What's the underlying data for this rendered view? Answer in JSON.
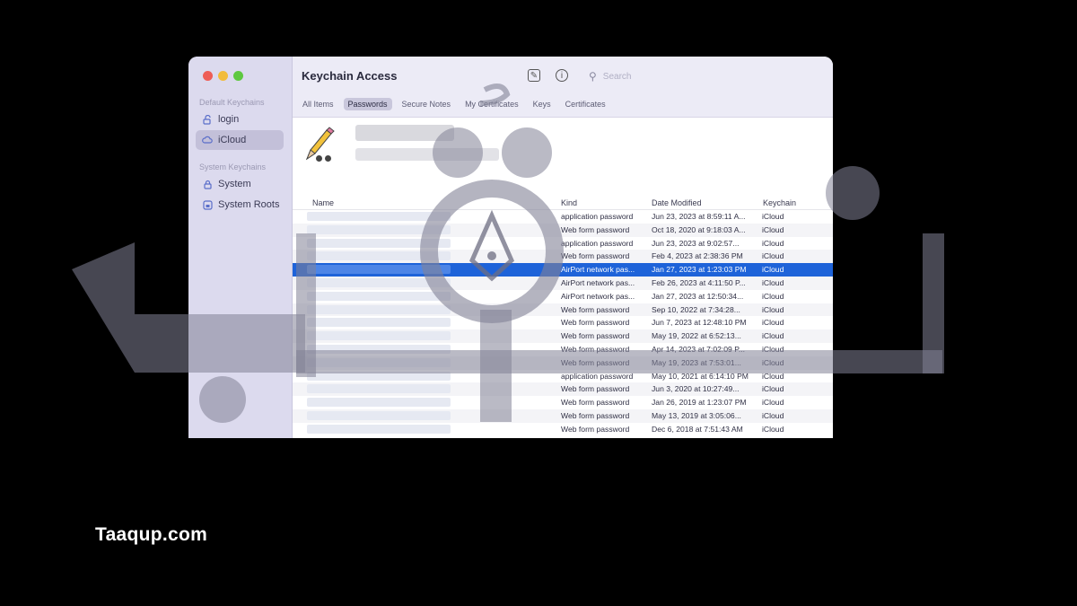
{
  "window": {
    "title": "Keychain Access"
  },
  "sidebar": {
    "sections": [
      {
        "label": "Default Keychains",
        "items": [
          {
            "label": "login",
            "icon": "unlock-icon",
            "selected": false
          },
          {
            "label": "iCloud",
            "icon": "cloud-icon",
            "selected": true
          }
        ]
      },
      {
        "label": "System Keychains",
        "items": [
          {
            "label": "System",
            "icon": "lock-icon",
            "selected": false
          },
          {
            "label": "System Roots",
            "icon": "lock-box-icon",
            "selected": false
          }
        ]
      }
    ]
  },
  "toolbar": {
    "search_placeholder": "Search"
  },
  "tabs": [
    {
      "label": "All Items",
      "active": false
    },
    {
      "label": "Passwords",
      "active": true
    },
    {
      "label": "Secure Notes",
      "active": false
    },
    {
      "label": "My Certificates",
      "active": false
    },
    {
      "label": "Keys",
      "active": false
    },
    {
      "label": "Certificates",
      "active": false
    }
  ],
  "table": {
    "columns": [
      "Name",
      "Kind",
      "Date Modified",
      "Keychain"
    ],
    "rows": [
      {
        "kind": "application password",
        "date": "Jun 23, 2023 at 8:59:11 A...",
        "keychain": "iCloud"
      },
      {
        "kind": "Web form password",
        "date": "Oct 18, 2020 at 9:18:03 A...",
        "keychain": "iCloud"
      },
      {
        "kind": "application password",
        "date": "Jun 23, 2023 at 9:02:57...",
        "keychain": "iCloud"
      },
      {
        "kind": "Web form password",
        "date": "Feb 4, 2023 at 2:38:36 PM",
        "keychain": "iCloud"
      },
      {
        "kind": "AirPort network pas...",
        "date": "Jan 27, 2023 at 1:23:03 PM",
        "keychain": "iCloud",
        "selected": true
      },
      {
        "kind": "AirPort network pas...",
        "date": "Feb 26, 2023 at 4:11:50 P...",
        "keychain": "iCloud"
      },
      {
        "kind": "AirPort network pas...",
        "date": "Jan 27, 2023 at 12:50:34...",
        "keychain": "iCloud"
      },
      {
        "kind": "Web form password",
        "date": "Sep 10, 2022 at 7:34:28...",
        "keychain": "iCloud"
      },
      {
        "kind": "Web form password",
        "date": "Jun 7, 2023 at 12:48:10 PM",
        "keychain": "iCloud"
      },
      {
        "kind": "Web form password",
        "date": "May 19, 2022 at 6:52:13...",
        "keychain": "iCloud"
      },
      {
        "kind": "Web form password",
        "date": "Apr 14, 2023 at 7:02:09 P...",
        "keychain": "iCloud"
      },
      {
        "kind": "Web form password",
        "date": "May 19, 2023 at 7:53:01...",
        "keychain": "iCloud"
      },
      {
        "kind": "application password",
        "date": "May 10, 2021 at 6:14:10 PM",
        "keychain": "iCloud"
      },
      {
        "kind": "Web form password",
        "date": "Jun 3, 2020 at 10:27:49...",
        "keychain": "iCloud"
      },
      {
        "kind": "Web form password",
        "date": "Jan 26, 2019 at 1:23:07 PM",
        "keychain": "iCloud"
      },
      {
        "kind": "Web form password",
        "date": "May 13, 2019 at 3:05:06...",
        "keychain": "iCloud"
      },
      {
        "kind": "Web form password",
        "date": "Dec 6, 2018 at 7:51:43 AM",
        "keychain": "iCloud"
      }
    ]
  },
  "footer": {
    "site": "Taaqup.com"
  }
}
